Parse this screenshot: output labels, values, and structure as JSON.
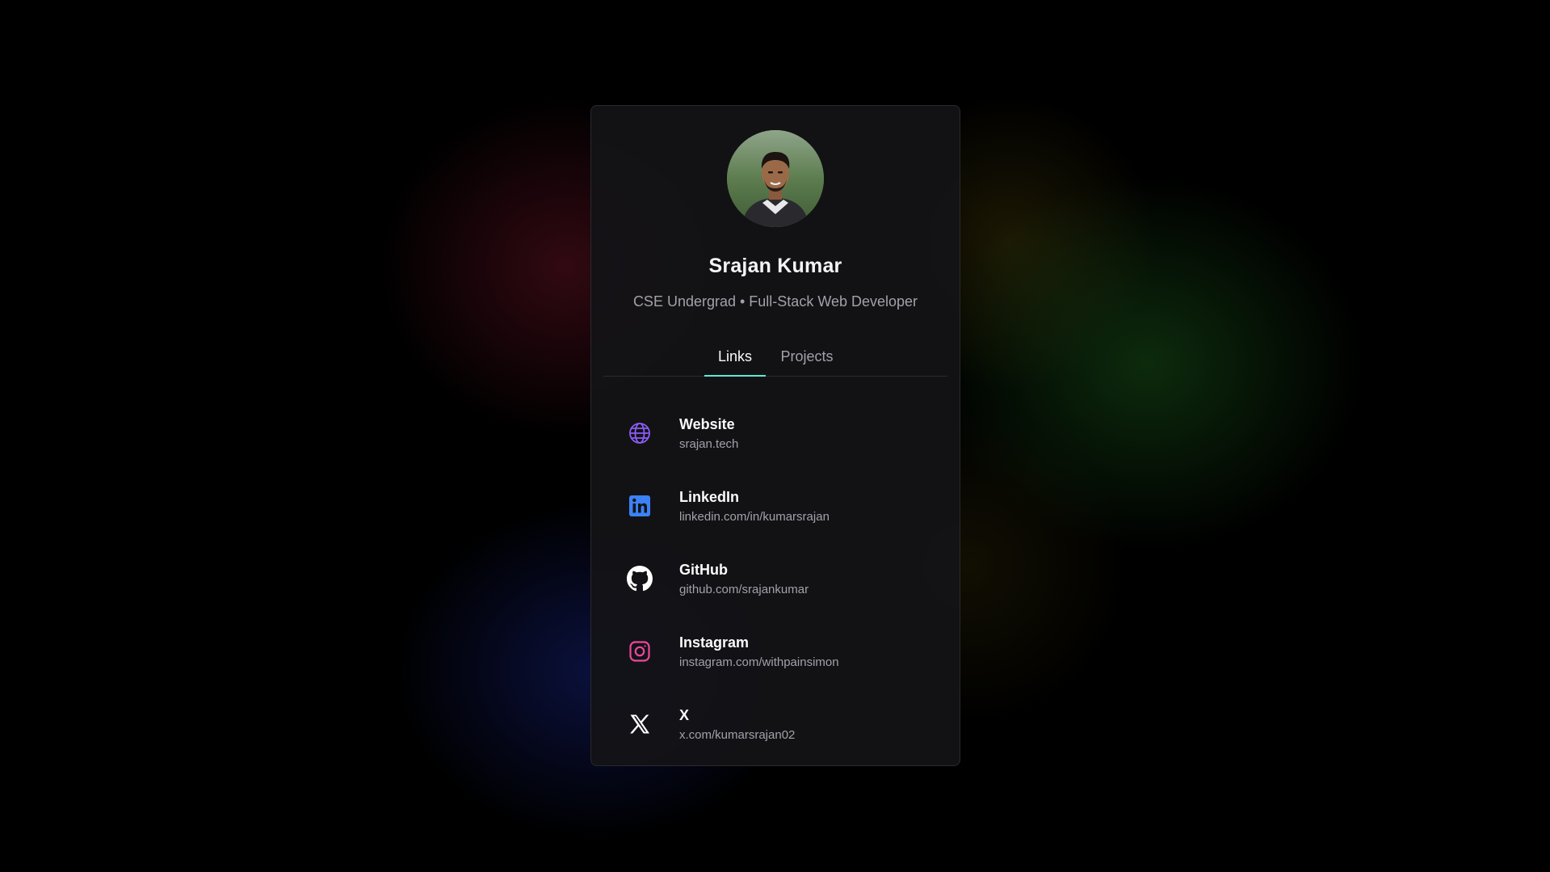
{
  "profile": {
    "name": "Srajan Kumar",
    "subtitle": "CSE Undergrad • Full-Stack Web Developer"
  },
  "tabs": [
    {
      "label": "Links",
      "active": true
    },
    {
      "label": "Projects",
      "active": false
    }
  ],
  "links": [
    {
      "title": "Website",
      "url": "srajan.tech",
      "icon": "globe-icon",
      "color": "#8b5cf6"
    },
    {
      "title": "LinkedIn",
      "url": "linkedin.com/in/kumarsrajan",
      "icon": "linkedin-icon",
      "color": "#3b82f6"
    },
    {
      "title": "GitHub",
      "url": "github.com/srajankumar",
      "icon": "github-icon",
      "color": "#ffffff"
    },
    {
      "title": "Instagram",
      "url": "instagram.com/withpainsimon",
      "icon": "instagram-icon",
      "color": "#ec4899"
    },
    {
      "title": "X",
      "url": "x.com/kumarsrajan02",
      "icon": "x-icon",
      "color": "#ffffff"
    }
  ],
  "colors": {
    "accent": "#5eead4",
    "card_background": "#141417",
    "text_primary": "#fafafa",
    "text_muted": "#a1a1aa"
  }
}
